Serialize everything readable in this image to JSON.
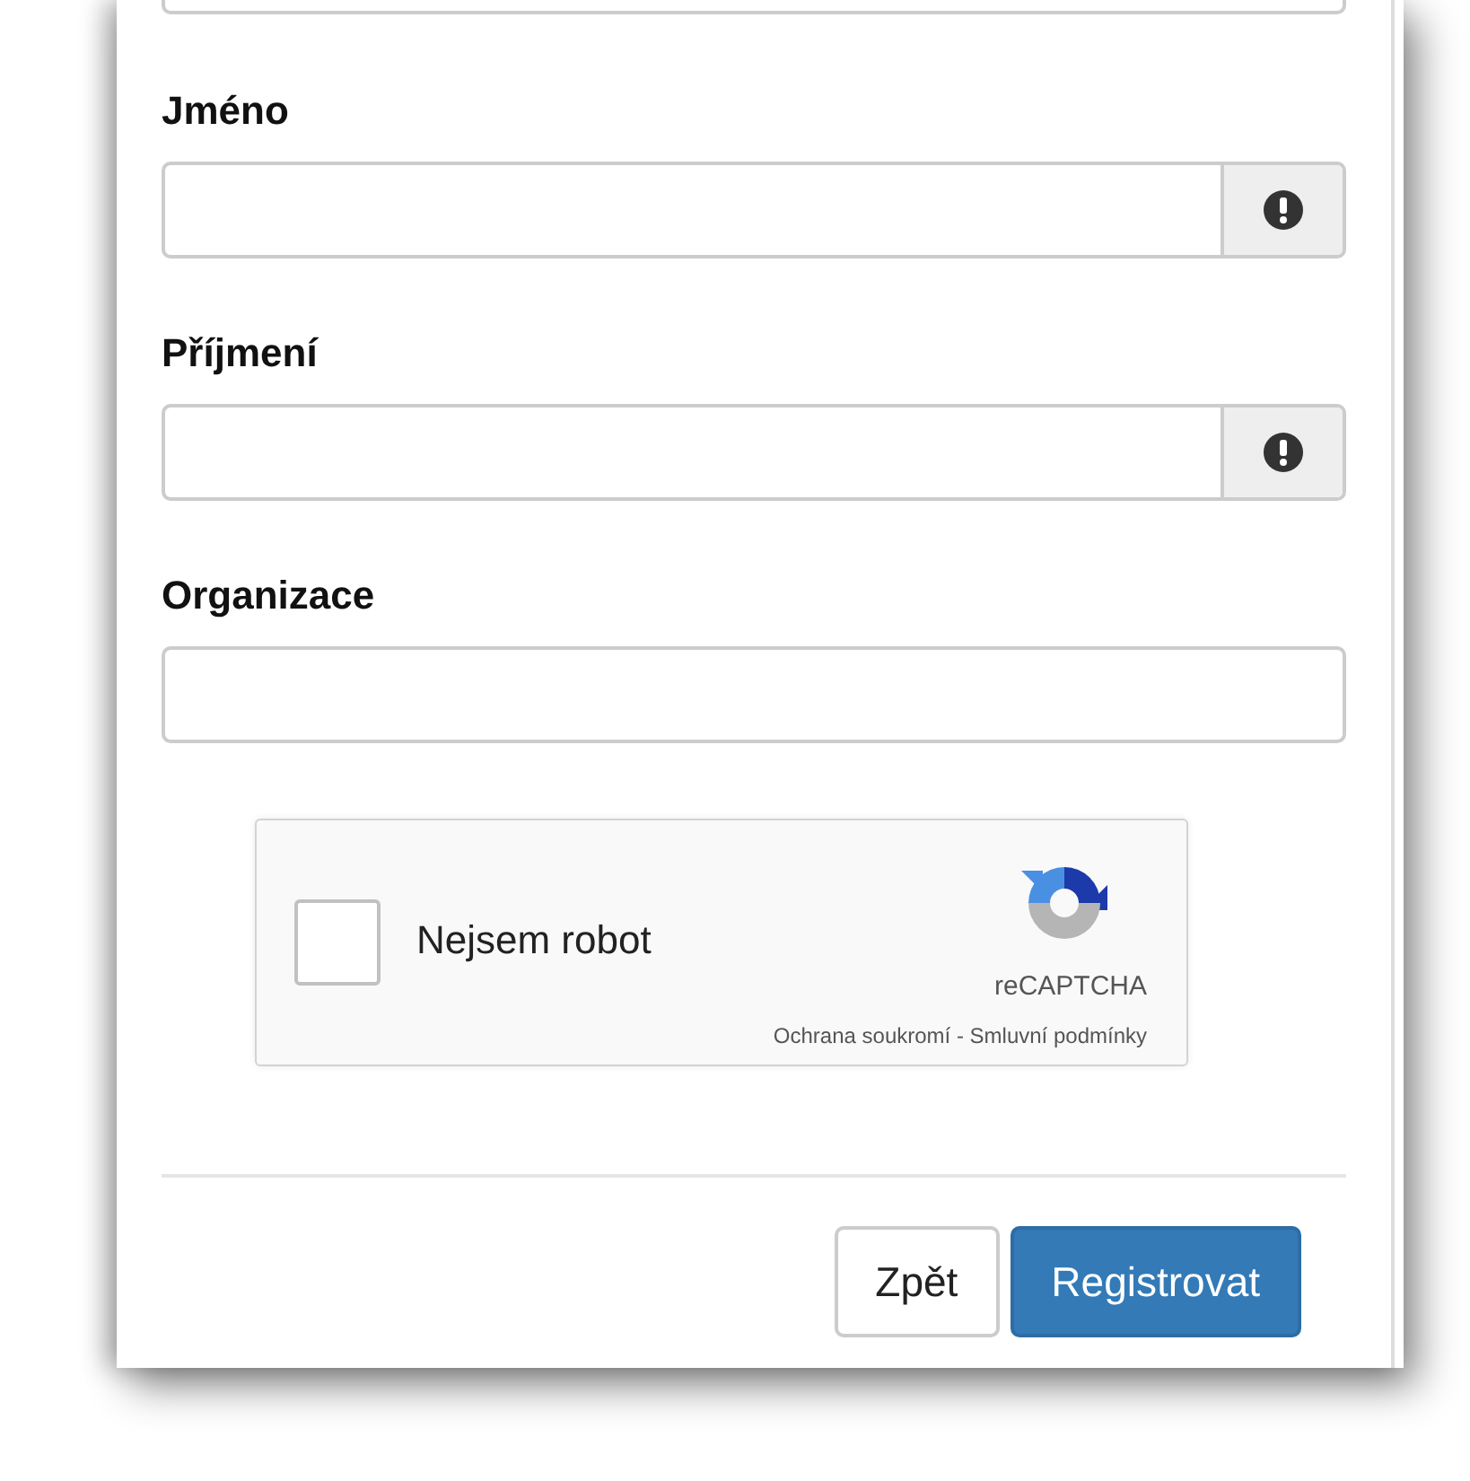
{
  "fields": [
    {
      "required_icon": false
    },
    {
      "label": "Jméno",
      "required_icon": true
    },
    {
      "label": "Příjmení",
      "required_icon": true
    },
    {
      "label": "Organizace",
      "required_icon": false
    }
  ],
  "captcha": {
    "checked": false,
    "label": "Nejsem robot",
    "brand": "reCAPTCHA",
    "links": "Ochrana soukromí - Smluvní podmínky"
  },
  "buttons": [
    {
      "label": "Zpět",
      "kind": "default"
    },
    {
      "label": "Registrovat",
      "kind": "primary"
    }
  ]
}
